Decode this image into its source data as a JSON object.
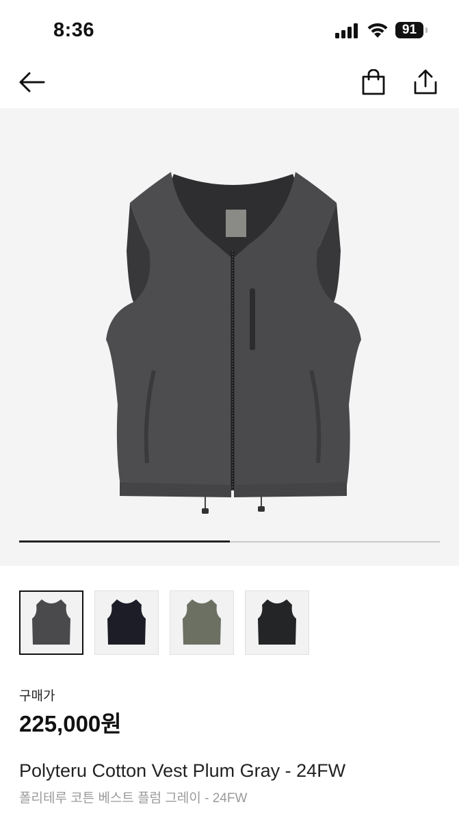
{
  "status_bar": {
    "time": "8:36",
    "battery": "91",
    "icons": [
      "signal-icon",
      "wifi-icon",
      "battery-icon"
    ]
  },
  "nav": {
    "icons": [
      "back-arrow-icon",
      "shopping-bag-icon",
      "share-icon"
    ]
  },
  "gallery": {
    "image_alt": "vest-product-image",
    "progress": 0.5
  },
  "thumbnails": [
    {
      "color": "#4a4a4c",
      "selected": true
    },
    {
      "color": "#1c1d26",
      "selected": false
    },
    {
      "color": "#6b7063",
      "selected": false
    },
    {
      "color": "#232526",
      "selected": false
    }
  ],
  "product": {
    "price_label": "구매가",
    "price": "225,000원",
    "name": "Polyteru Cotton Vest Plum Gray - 24FW",
    "subname": "폴리테루 코튼 베스트 플럼 그레이 - 24FW"
  }
}
